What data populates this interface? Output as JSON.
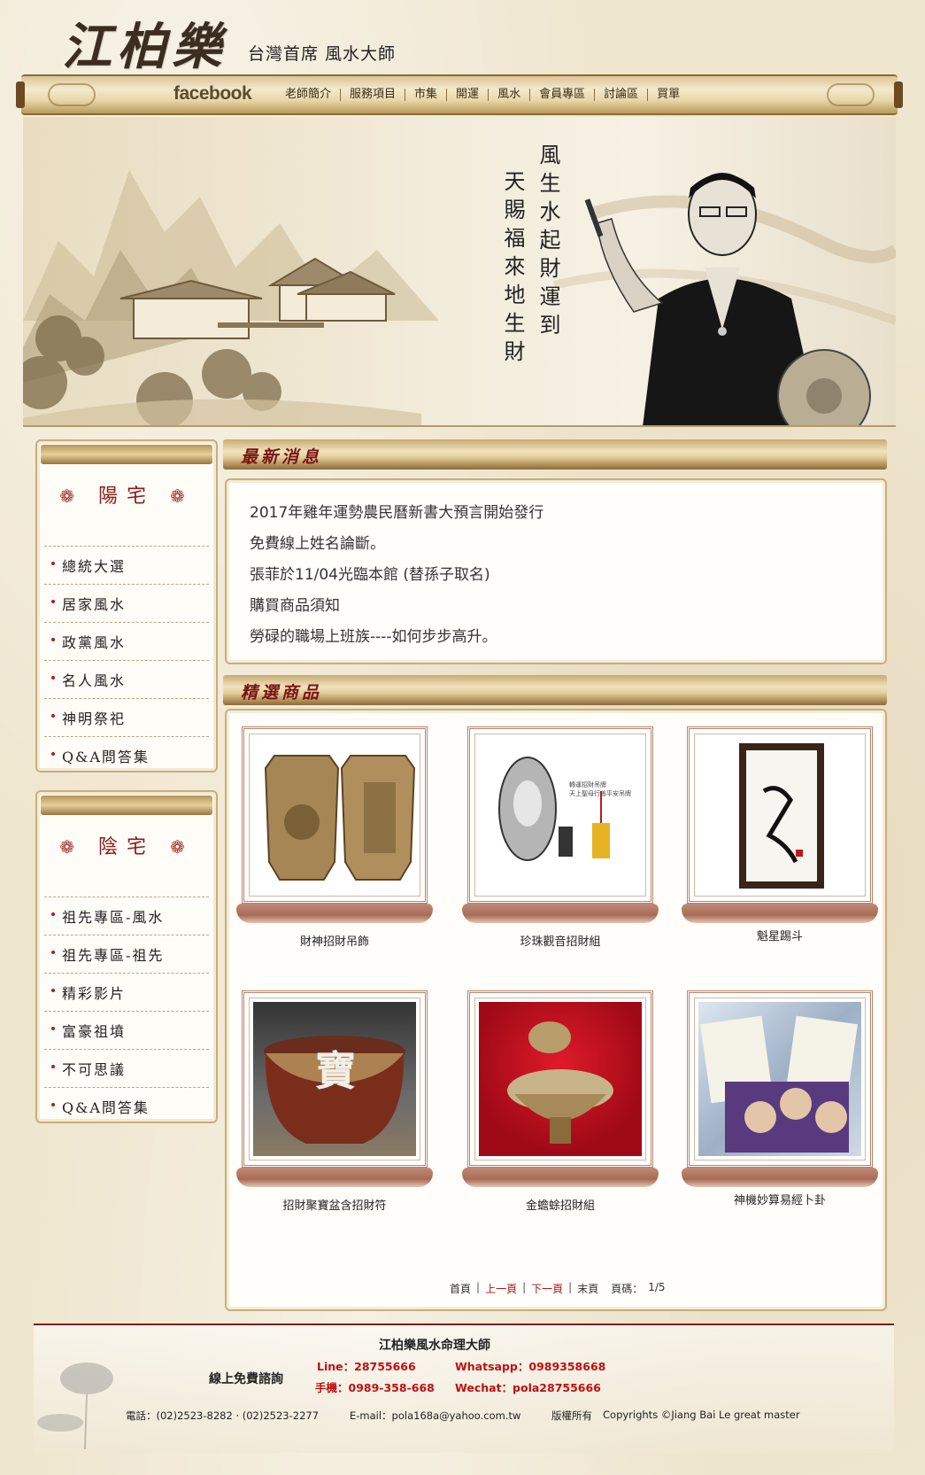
{
  "header": {
    "logo": "江柏樂",
    "subtitle": "台灣首席 風水大師"
  },
  "nav": {
    "facebook": "facebook",
    "items": [
      "老師簡介",
      "服務項目",
      "市集",
      "開運",
      "風水",
      "會員專區",
      "討論區",
      "買單"
    ]
  },
  "banner": {
    "poem_line1": "風生水起財運到",
    "poem_line2": "天賜福來地生財"
  },
  "sidebar_yang": {
    "title": "陽宅",
    "items": [
      "總統大選",
      "居家風水",
      "政黨風水",
      "名人風水",
      "神明祭祀",
      "Q&A問答集"
    ]
  },
  "sidebar_yin": {
    "title": "陰宅",
    "items": [
      "祖先專區-風水",
      "祖先專區-祖先",
      "精彩影片",
      "富豪祖墳",
      "不可思議",
      "Q&A問答集"
    ]
  },
  "news": {
    "title": "最新消息",
    "items": [
      "2017年雞年運勢農民曆新書大預言開始發行",
      "免費線上姓名論斷。",
      "張菲於11/04光臨本館 (替孫子取名)",
      "購買商品須知",
      "勞碌的職場上班族----如何步步高升。"
    ]
  },
  "products": {
    "title": "精選商品",
    "items": [
      {
        "name": "財神招財吊飾"
      },
      {
        "name": "珍珠觀音招財組"
      },
      {
        "name": "魁星踢斗"
      },
      {
        "name": "招財聚寶盆含招財符"
      },
      {
        "name": "金蟾蜍招財組"
      },
      {
        "name": "神機妙算易經卜卦"
      }
    ],
    "img_text": {
      "bowl": "寶",
      "pendant_caption": "轉運招財吊牌",
      "pendant_caption2": "天上聖母行善平安吊牌"
    }
  },
  "pager": {
    "first": "首頁",
    "prev": "上一頁",
    "next": "下一頁",
    "last": "末頁",
    "page_label": "頁碼：",
    "page_value": "1/5"
  },
  "footer": {
    "title": "江柏樂風水命理大師",
    "consult": "線上免費諮詢",
    "line": "Line：28755666",
    "mobile": "手機：0989-358-668",
    "whatsapp": "Whatsapp：0989358668",
    "wechat": "Wechat：pola28755666",
    "phone": "電話：(02)2523-8282 · (02)2523-2277",
    "email": "E-mail：pola168a@yahoo.com.tw",
    "copyright_label": "版權所有",
    "copyright": "Copyrights ©Jiang Bai Le great master"
  },
  "colors": {
    "accent_red": "#8b1a1a",
    "gold": "#c9ab73",
    "brown": "#8d6a32"
  }
}
